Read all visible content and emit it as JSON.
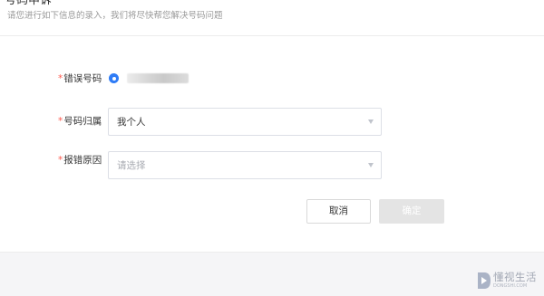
{
  "header": {
    "title": "号码申诉",
    "subtitle": "请您进行如下信息的录入，我们将尽快帮您解决号码问题"
  },
  "form": {
    "required_mark": "*",
    "wrong_number": {
      "label": "错误号码"
    },
    "ownership": {
      "label": "号码归属",
      "value": "我个人"
    },
    "reason": {
      "label": "报错原因",
      "placeholder": "请选择"
    }
  },
  "actions": {
    "cancel_label": "取消",
    "confirm_label": "确定"
  },
  "watermark": {
    "text": "懂视生活",
    "sub": "DONGSHI.COM"
  },
  "colors": {
    "accent": "#2f7cf6",
    "required": "#ff5a4e",
    "disabled_button": "#e4e4e4",
    "footer_bg": "#f5f5f7"
  }
}
